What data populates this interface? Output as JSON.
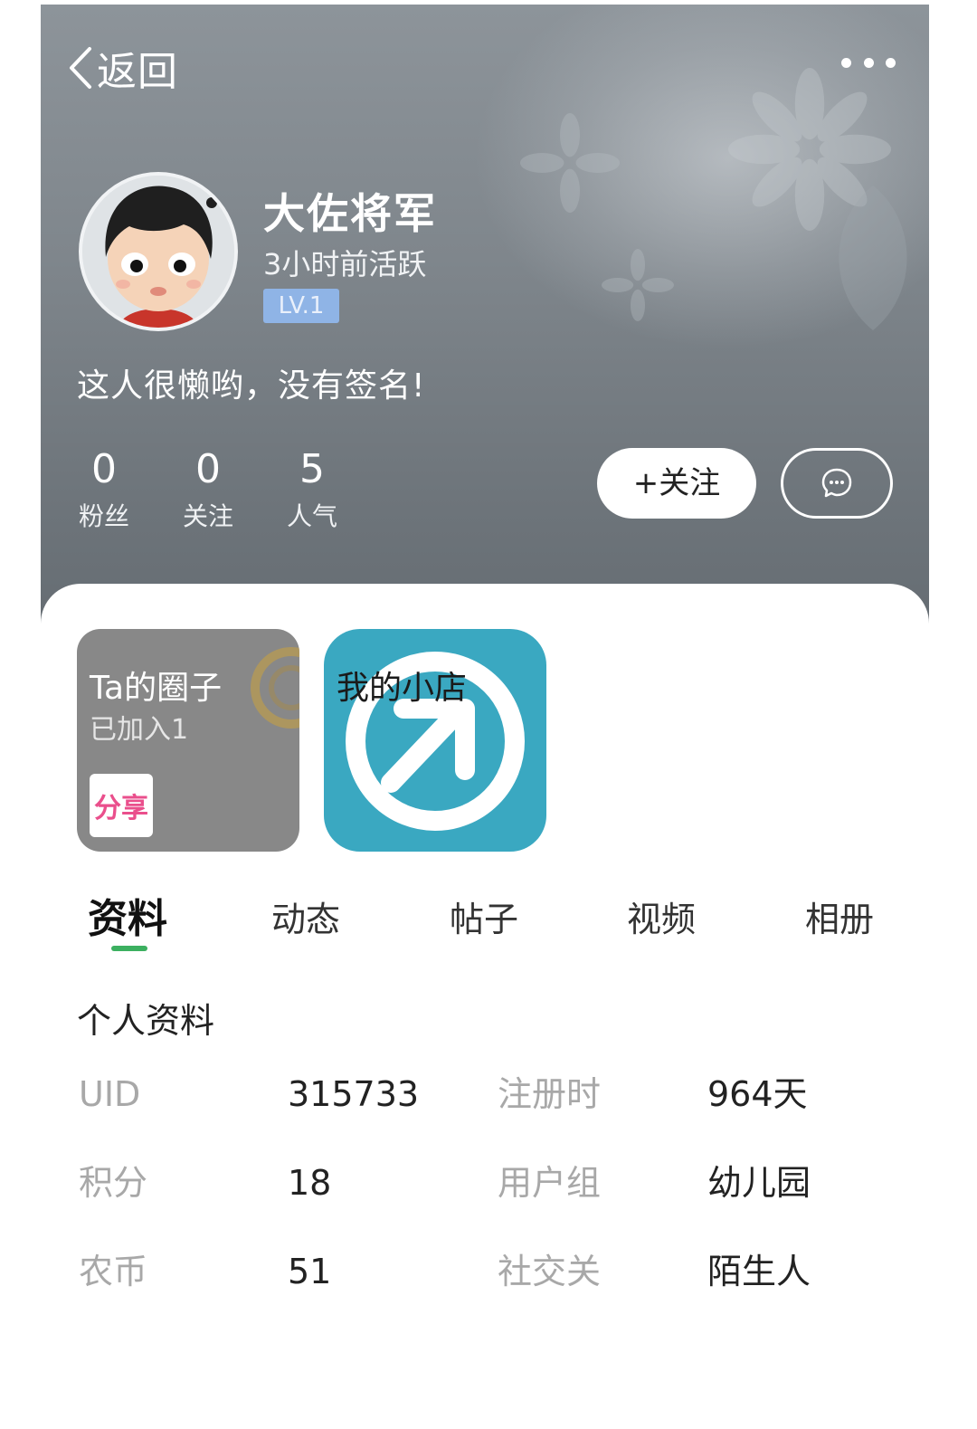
{
  "header": {
    "back_label": "返回",
    "username": "大佐将军",
    "active_status": "3小时前活跃",
    "level": "LV.1",
    "signature": "这人很懒哟，没有签名!",
    "stats": [
      {
        "value": "0",
        "label": "粉丝"
      },
      {
        "value": "0",
        "label": "关注"
      },
      {
        "value": "5",
        "label": "人气"
      }
    ],
    "follow_label": "+关注"
  },
  "tiles": {
    "circle_title": "Ta的圈子",
    "circle_subtitle": "已加入1",
    "share_badge": "分享",
    "shop_title": "我的小店"
  },
  "tabs": [
    "资料",
    "动态",
    "帖子",
    "视频",
    "相册"
  ],
  "active_tab": "资料",
  "profile": {
    "section_title": "个人资料",
    "rows": [
      {
        "k1": "UID",
        "v1": "315733",
        "k2": "注册时",
        "v2": "964天"
      },
      {
        "k1": "积分",
        "v1": "18",
        "k2": "用户组",
        "v2": "幼儿园"
      },
      {
        "k1": "农币",
        "v1": "51",
        "k2": "社交关",
        "v2": "陌生人"
      }
    ]
  },
  "colors": {
    "accent_green": "#3cb060",
    "level_badge": "#8fb4e6",
    "shop_teal": "#3aa8c1"
  }
}
